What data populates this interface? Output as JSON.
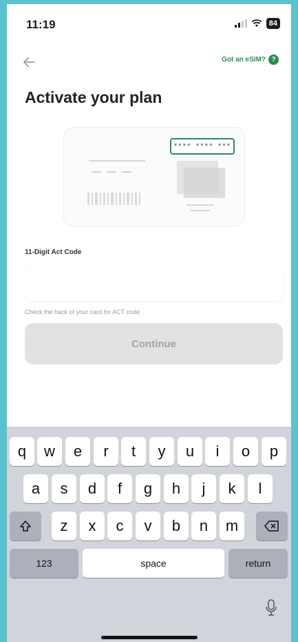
{
  "status": {
    "time": "11:19",
    "battery": "84"
  },
  "nav": {
    "esim_link": "Got an eSIM?",
    "help_glyph": "?"
  },
  "title": "Activate your plan",
  "card": {
    "code_sample": "**** **** ***"
  },
  "form": {
    "label": "11-Digit Act Code",
    "value": "",
    "helper": "Check the back of your card for ACT code",
    "continue_label": "Continue"
  },
  "keyboard": {
    "row1": [
      "q",
      "w",
      "e",
      "r",
      "t",
      "y",
      "u",
      "i",
      "o",
      "p"
    ],
    "row2": [
      "a",
      "s",
      "d",
      "f",
      "g",
      "h",
      "j",
      "k",
      "l"
    ],
    "row3": [
      "z",
      "x",
      "c",
      "v",
      "b",
      "n",
      "m"
    ],
    "numbers_label": "123",
    "space_label": "space",
    "return_label": "return"
  },
  "colors": {
    "accent": "#2e8b57",
    "frame": "#5bc3cd",
    "disabled_button": "#e2e2e2",
    "keyboard_bg": "#d1d4da"
  },
  "icons": [
    "back-arrow-icon",
    "help-icon",
    "camera-icon",
    "shift-icon",
    "backspace-icon",
    "mic-icon",
    "signal-icon",
    "wifi-icon",
    "battery-icon"
  ]
}
